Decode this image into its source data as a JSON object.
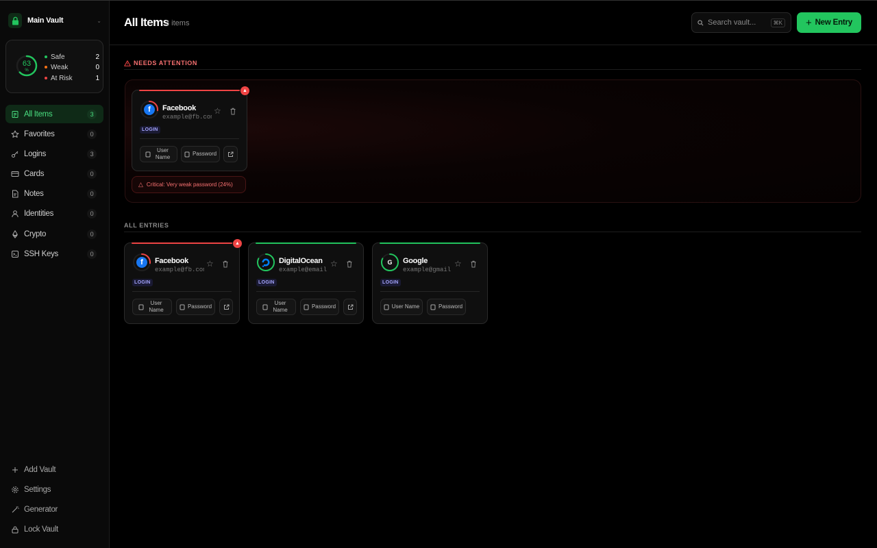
{
  "sidebar": {
    "vault_name": "Main Vault",
    "health": {
      "score": "63",
      "unit": "%",
      "score_fraction": 0.63,
      "stats": [
        {
          "label": "Safe",
          "count": "2",
          "color": "#22c55e"
        },
        {
          "label": "Weak",
          "count": "0",
          "color": "#f97316"
        },
        {
          "label": "At Risk",
          "count": "1",
          "color": "#ef4444"
        }
      ]
    },
    "nav": [
      {
        "label": "All Items",
        "count": "3",
        "icon": "list-icon"
      },
      {
        "label": "Favorites",
        "count": "0",
        "icon": "star-icon"
      },
      {
        "label": "Logins",
        "count": "3",
        "icon": "key-icon"
      },
      {
        "label": "Cards",
        "count": "0",
        "icon": "card-icon"
      },
      {
        "label": "Notes",
        "count": "0",
        "icon": "note-icon"
      },
      {
        "label": "Identities",
        "count": "0",
        "icon": "user-icon"
      },
      {
        "label": "Crypto",
        "count": "0",
        "icon": "ethereum-icon"
      },
      {
        "label": "SSH Keys",
        "count": "0",
        "icon": "terminal-icon"
      }
    ],
    "bottom": [
      {
        "label": "Add Vault",
        "icon": "plus-icon"
      },
      {
        "label": "Settings",
        "icon": "gear-icon"
      },
      {
        "label": "Generator",
        "icon": "wand-icon"
      },
      {
        "label": "Lock Vault",
        "icon": "lock-icon"
      }
    ]
  },
  "header": {
    "title": "All Items",
    "count": "3 items",
    "search_placeholder": "Search vault...",
    "search_shortcut": "⌘K",
    "new_button": "New Entry"
  },
  "attention": {
    "heading": "NEEDS ATTENTION",
    "card": {
      "name": "Facebook",
      "email": "example@fb.com",
      "type": "LOGIN",
      "username_btn": "User Name",
      "password_btn": "Password",
      "strength": 0.24,
      "status_color": "#ef4444"
    },
    "message": "Critical: Very weak password (24%)"
  },
  "entries": {
    "heading": "ALL ENTRIES",
    "items": [
      {
        "name": "Facebook",
        "email": "example@fb.com",
        "type": "LOGIN",
        "username_btn": "User Name",
        "password_btn": "Password",
        "has_link": true,
        "status_color": "#ef4444",
        "logo": "facebook-icon"
      },
      {
        "name": "DigitalOcean",
        "email": "example@email...",
        "type": "LOGIN",
        "username_btn": "User Name",
        "password_btn": "Password",
        "has_link": true,
        "status_color": "#22c55e",
        "logo": "digitalocean-icon"
      },
      {
        "name": "Google",
        "email": "example@gmail...",
        "type": "LOGIN",
        "username_btn": "User Name",
        "password_btn": "Password",
        "has_link": false,
        "status_color": "#22c55e",
        "logo": "google-icon",
        "logo_letter": "G"
      }
    ]
  },
  "colors": {
    "accent": "#22c55e",
    "danger": "#ef4444",
    "warning": "#f97316"
  }
}
